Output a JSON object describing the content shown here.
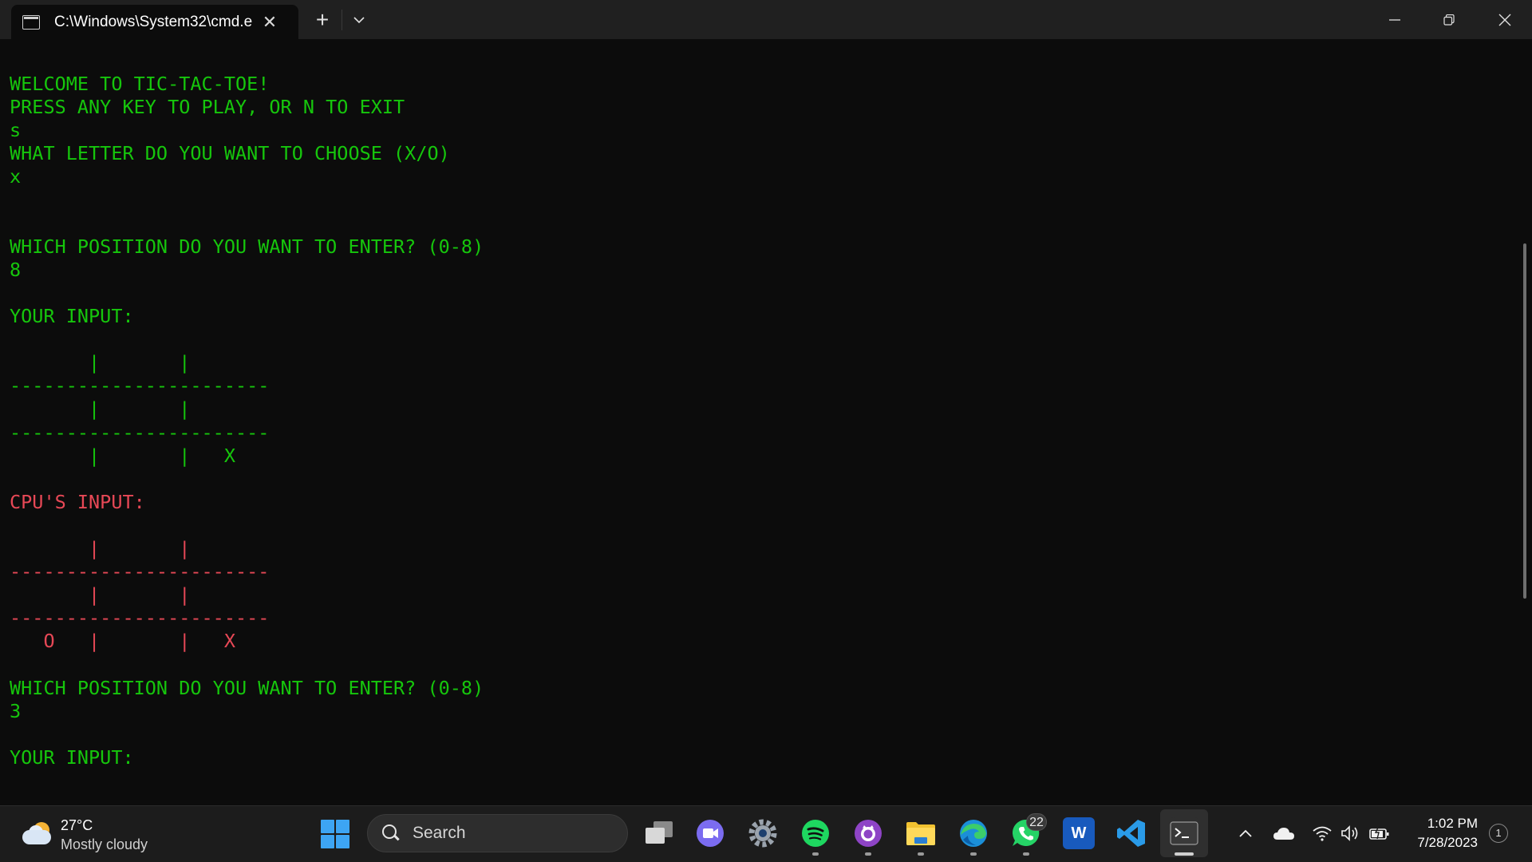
{
  "window": {
    "tab_title": "C:\\Windows\\System32\\cmd.e",
    "tab_close": "✕",
    "new_tab": "+",
    "tab_dropdown": "⌄"
  },
  "terminal": {
    "lines": [
      {
        "text": "WELCOME TO TIC-TAC-TOE!",
        "color": "green"
      },
      {
        "text": "PRESS ANY KEY TO PLAY, OR N TO EXIT",
        "color": "green"
      },
      {
        "text": "s",
        "color": "green"
      },
      {
        "text": "WHAT LETTER DO YOU WANT TO CHOOSE (X/O)",
        "color": "green"
      },
      {
        "text": "x",
        "color": "green"
      },
      {
        "text": "",
        "color": "green"
      },
      {
        "text": "",
        "color": "green"
      },
      {
        "text": "WHICH POSITION DO YOU WANT TO ENTER? (0-8)",
        "color": "green"
      },
      {
        "text": "8",
        "color": "green"
      },
      {
        "text": "",
        "color": "green"
      },
      {
        "text": "YOUR INPUT:",
        "color": "green"
      },
      {
        "text": "",
        "color": "green"
      },
      {
        "text": "       |       |",
        "color": "green"
      },
      {
        "text": "-----------------------",
        "color": "green"
      },
      {
        "text": "       |       |",
        "color": "green"
      },
      {
        "text": "-----------------------",
        "color": "green"
      },
      {
        "text": "       |       |   X",
        "color": "green"
      },
      {
        "text": "",
        "color": "green"
      },
      {
        "text": "CPU'S INPUT:",
        "color": "red"
      },
      {
        "text": "",
        "color": "red"
      },
      {
        "text": "       |       |",
        "color": "red"
      },
      {
        "text": "-----------------------",
        "color": "red"
      },
      {
        "text": "       |       |",
        "color": "red"
      },
      {
        "text": "-----------------------",
        "color": "red"
      },
      {
        "text": "   O   |       |   X",
        "color": "red"
      },
      {
        "text": "",
        "color": "green"
      },
      {
        "text": "WHICH POSITION DO YOU WANT TO ENTER? (0-8)",
        "color": "green"
      },
      {
        "text": "3",
        "color": "green"
      },
      {
        "text": "",
        "color": "green"
      },
      {
        "text": "YOUR INPUT:",
        "color": "green"
      }
    ]
  },
  "taskbar": {
    "weather": {
      "temp": "27°C",
      "condition": "Mostly cloudy"
    },
    "search_placeholder": "Search",
    "apps": [
      {
        "name": "task-view",
        "label": ""
      },
      {
        "name": "teams-meet",
        "label": ""
      },
      {
        "name": "settings",
        "label": ""
      },
      {
        "name": "spotify",
        "label": ""
      },
      {
        "name": "github-desktop",
        "label": ""
      },
      {
        "name": "file-explorer",
        "label": ""
      },
      {
        "name": "edge",
        "label": ""
      },
      {
        "name": "whatsapp",
        "label": ""
      },
      {
        "name": "word",
        "label": "W"
      },
      {
        "name": "vscode",
        "label": ""
      },
      {
        "name": "terminal",
        "label": ">_"
      }
    ],
    "whatsapp_badge": "22",
    "clock": {
      "time": "1:02 PM",
      "date": "7/28/2023"
    },
    "notification_count": "1",
    "colors": {
      "terminal_green": "#16c60c",
      "terminal_red": "#e74856",
      "taskbar": "#1c1c1c"
    }
  }
}
